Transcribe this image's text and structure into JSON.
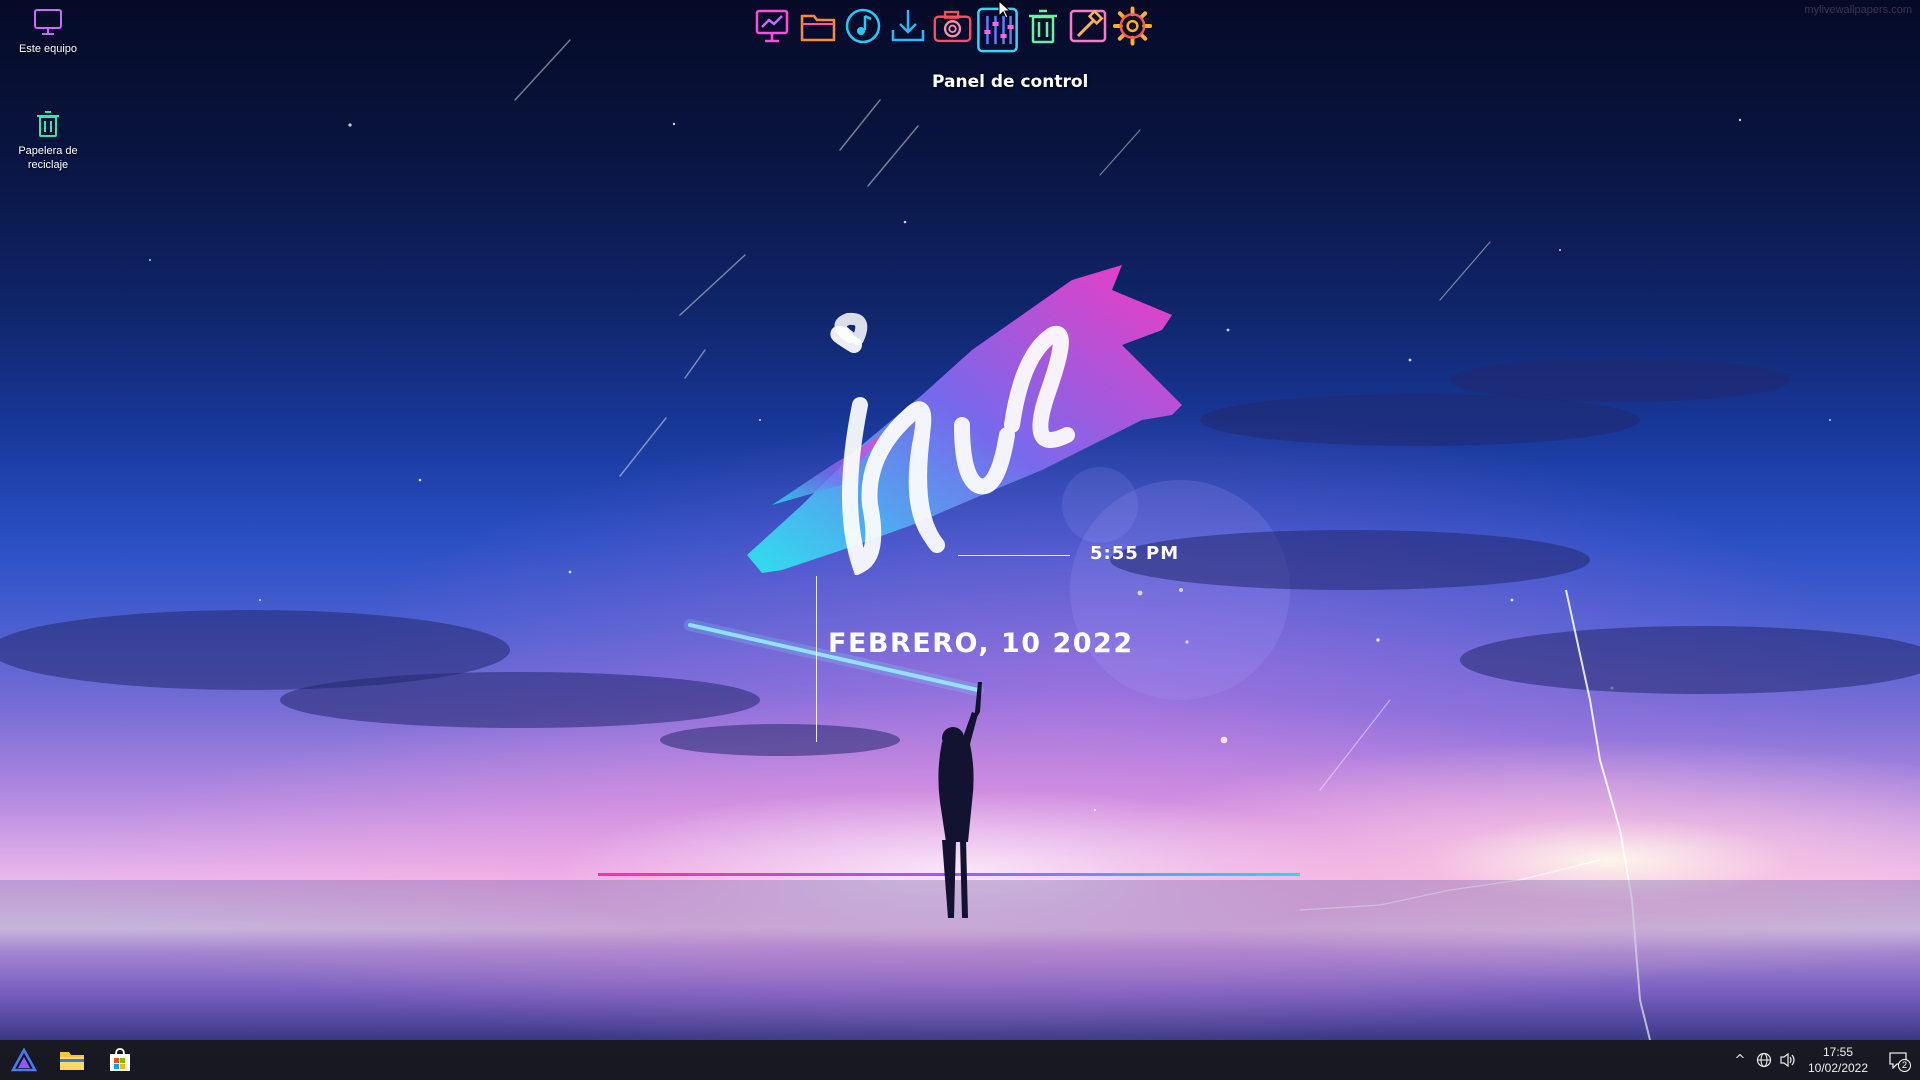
{
  "watermark": "mylivewallpapers.com",
  "desktop_icons": [
    {
      "label": "Este equipo",
      "icon": "computer-icon"
    },
    {
      "label": "Papelera de reciclaje",
      "icon": "recycle-bin-icon"
    }
  ],
  "dock": {
    "items": [
      {
        "name": "monitor",
        "icon": "monitor-chart-icon",
        "color": "#ff4fd8"
      },
      {
        "name": "folder",
        "icon": "folder-icon",
        "color": "#ff8a3d"
      },
      {
        "name": "music",
        "icon": "music-disc-icon",
        "color": "#27c7ff"
      },
      {
        "name": "download",
        "icon": "download-icon",
        "color": "#33b4ff"
      },
      {
        "name": "camera",
        "icon": "camera-icon",
        "color": "#ff4f5e"
      },
      {
        "name": "control-panel",
        "icon": "equalizer-icon",
        "color": "#39d2ff",
        "active": true
      },
      {
        "name": "trash",
        "icon": "trash-icon",
        "color": "#6cf0a0"
      },
      {
        "name": "tools",
        "icon": "tools-icon",
        "color": "#ff7ac7"
      },
      {
        "name": "settings",
        "icon": "gear-icon",
        "color": "#ffb02e"
      }
    ],
    "tooltip": "Panel de control"
  },
  "widget": {
    "time": "5:55 PM",
    "date": "FEBRERO, 10 2022",
    "brush_colors": [
      "#2ee6f0",
      "#7b6cf0",
      "#ff3cc8"
    ]
  },
  "taskbar": {
    "buttons": [
      {
        "name": "start",
        "icon": "start-triangle-icon"
      },
      {
        "name": "file-explorer",
        "icon": "folder-icon"
      },
      {
        "name": "store",
        "icon": "store-bag-icon"
      }
    ],
    "tray": {
      "chevron": "^",
      "network_icon": "globe-icon",
      "volume_icon": "speaker-icon",
      "clock_time": "17:55",
      "clock_date": "10/02/2022",
      "notification_count": "2"
    }
  }
}
